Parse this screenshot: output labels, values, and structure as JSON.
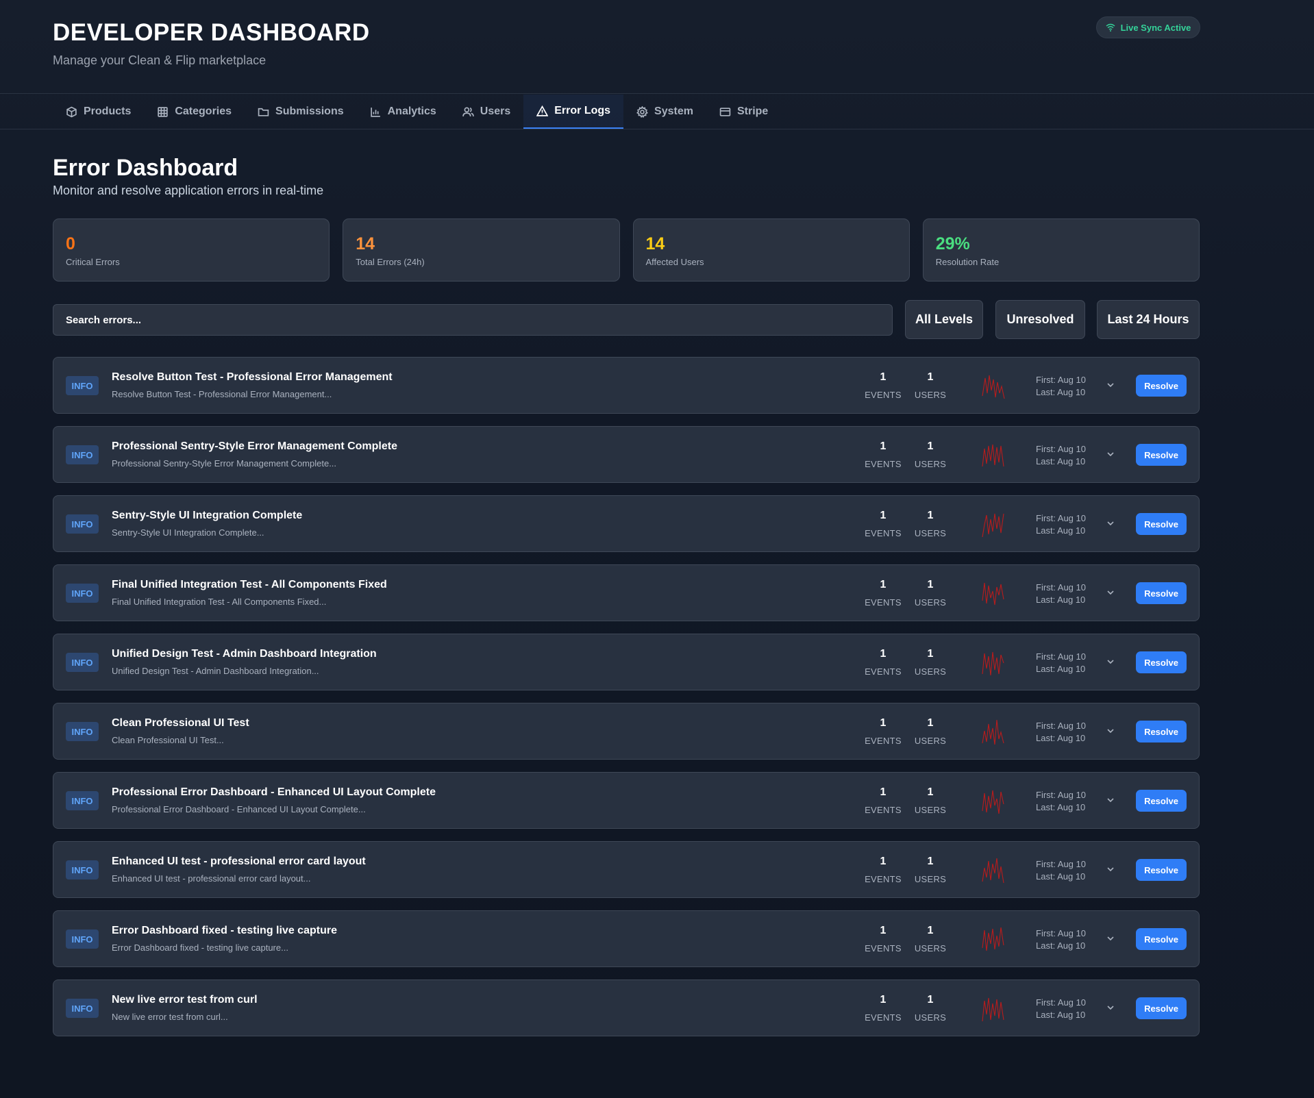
{
  "header": {
    "title": "DEVELOPER DASHBOARD",
    "subtitle": "Manage your Clean & Flip marketplace",
    "sync_status": "Live Sync Active"
  },
  "tabs": [
    {
      "label": "Products",
      "icon": "package-icon",
      "active": false
    },
    {
      "label": "Categories",
      "icon": "grid-icon",
      "active": false
    },
    {
      "label": "Submissions",
      "icon": "folder-icon",
      "active": false
    },
    {
      "label": "Analytics",
      "icon": "bar-chart-icon",
      "active": false
    },
    {
      "label": "Users",
      "icon": "users-icon",
      "active": false
    },
    {
      "label": "Error Logs",
      "icon": "alert-triangle-icon",
      "active": true
    },
    {
      "label": "System",
      "icon": "gear-icon",
      "active": false
    },
    {
      "label": "Stripe",
      "icon": "credit-card-icon",
      "active": false
    }
  ],
  "page": {
    "title": "Error Dashboard",
    "subtitle": "Monitor and resolve application errors in real-time"
  },
  "stats": [
    {
      "value": "0",
      "label": "Critical Errors",
      "color": "#f97316"
    },
    {
      "value": "14",
      "label": "Total Errors (24h)",
      "color": "#fb923c"
    },
    {
      "value": "14",
      "label": "Affected Users",
      "color": "#facc15"
    },
    {
      "value": "29%",
      "label": "Resolution Rate",
      "color": "#4ade80"
    }
  ],
  "search": {
    "placeholder": "Search errors..."
  },
  "filters": {
    "level": "All Levels",
    "status": "Unresolved",
    "range": "Last 24 Hours"
  },
  "labels": {
    "events": "EVENTS",
    "users": "USERS",
    "resolve": "Resolve"
  },
  "colors": {
    "accent": "#2f7df6",
    "sparkline": "#b91c1c",
    "live": "#34d399"
  },
  "errors": [
    {
      "level": "INFO",
      "title": "Resolve Button Test - Professional Error Management",
      "desc": "Resolve Button Test - Professional Error Management...",
      "events": "1",
      "users": "1",
      "first": "First: Aug 10",
      "last": "Last: Aug 10"
    },
    {
      "level": "INFO",
      "title": "Professional Sentry-Style Error Management Complete",
      "desc": "Professional Sentry-Style Error Management Complete...",
      "events": "1",
      "users": "1",
      "first": "First: Aug 10",
      "last": "Last: Aug 10"
    },
    {
      "level": "INFO",
      "title": "Sentry-Style UI Integration Complete",
      "desc": "Sentry-Style UI Integration Complete...",
      "events": "1",
      "users": "1",
      "first": "First: Aug 10",
      "last": "Last: Aug 10"
    },
    {
      "level": "INFO",
      "title": "Final Unified Integration Test - All Components Fixed",
      "desc": "Final Unified Integration Test - All Components Fixed...",
      "events": "1",
      "users": "1",
      "first": "First: Aug 10",
      "last": "Last: Aug 10"
    },
    {
      "level": "INFO",
      "title": "Unified Design Test - Admin Dashboard Integration",
      "desc": "Unified Design Test - Admin Dashboard Integration...",
      "events": "1",
      "users": "1",
      "first": "First: Aug 10",
      "last": "Last: Aug 10"
    },
    {
      "level": "INFO",
      "title": "Clean Professional UI Test",
      "desc": "Clean Professional UI Test...",
      "events": "1",
      "users": "1",
      "first": "First: Aug 10",
      "last": "Last: Aug 10"
    },
    {
      "level": "INFO",
      "title": "Professional Error Dashboard - Enhanced UI Layout Complete",
      "desc": "Professional Error Dashboard - Enhanced UI Layout Complete...",
      "events": "1",
      "users": "1",
      "first": "First: Aug 10",
      "last": "Last: Aug 10"
    },
    {
      "level": "INFO",
      "title": "Enhanced UI test - professional error card layout",
      "desc": "Enhanced UI test - professional error card layout...",
      "events": "1",
      "users": "1",
      "first": "First: Aug 10",
      "last": "Last: Aug 10"
    },
    {
      "level": "INFO",
      "title": "Error Dashboard fixed - testing live capture",
      "desc": "Error Dashboard fixed - testing live capture...",
      "events": "1",
      "users": "1",
      "first": "First: Aug 10",
      "last": "Last: Aug 10"
    },
    {
      "level": "INFO",
      "title": "New live error test from curl",
      "desc": "New live error test from curl...",
      "events": "1",
      "users": "1",
      "first": "First: Aug 10",
      "last": "Last: Aug 10"
    }
  ]
}
